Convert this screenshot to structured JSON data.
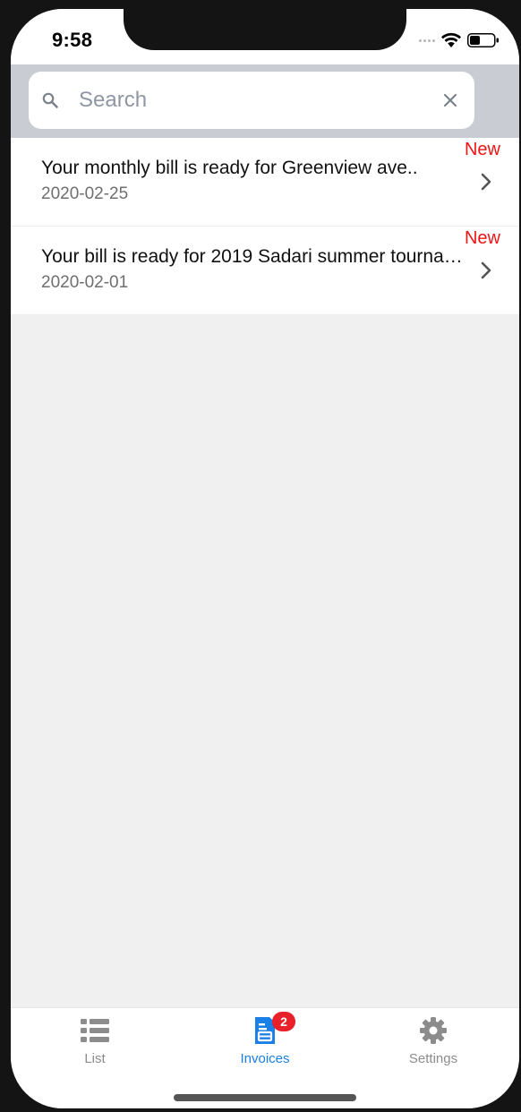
{
  "status_bar": {
    "time": "9:58",
    "icons": [
      "signal-icon",
      "wifi-icon",
      "battery-icon"
    ]
  },
  "search": {
    "placeholder": "Search",
    "value": "",
    "icon": "search-icon",
    "clear_icon": "close-icon"
  },
  "invoices": [
    {
      "title": "Your monthly bill is ready for Greenview ave..",
      "date": "2020-02-25",
      "badge": "New"
    },
    {
      "title": "Your bill is ready for 2019 Sadari summer tourna…",
      "date": "2020-02-01",
      "badge": "New"
    }
  ],
  "tabbar": {
    "tabs": [
      {
        "label": "List",
        "icon": "list-icon",
        "active": false
      },
      {
        "label": "Invoices",
        "icon": "invoice-icon",
        "active": true,
        "badge": "2"
      },
      {
        "label": "Settings",
        "icon": "gear-icon",
        "active": false
      }
    ]
  },
  "colors": {
    "accent": "#1a7fe6",
    "badge_new": "#f01414",
    "tab_badge": "#e8202a",
    "search_area_bg": "#c9ccd3",
    "list_bg": "#f0f0f0"
  }
}
